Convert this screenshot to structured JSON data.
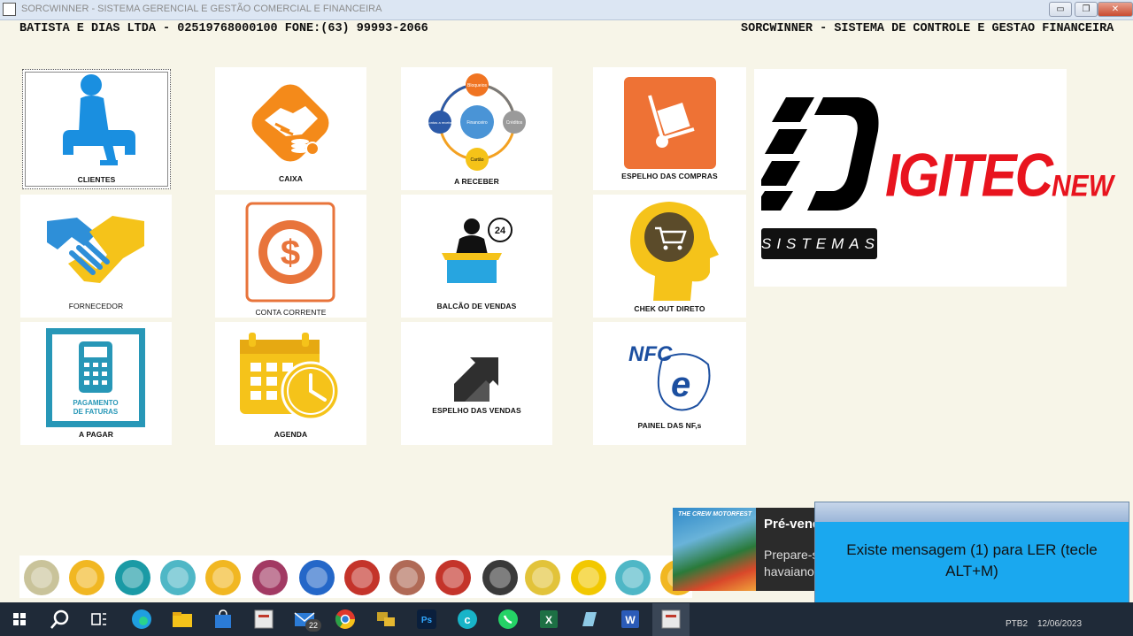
{
  "window": {
    "title": "SORCWINNER - SISTEMA GERENCIAL E GESTÃO COMERCIAL E FINANCEIRA",
    "minimize": "▭",
    "restore": "❐",
    "close": "✕"
  },
  "header": {
    "company": "BATISTA E DIAS LTDA - 02519768000100 FONE:(63) 99993-2066",
    "system": "SORCWINNER -  SISTEMA DE CONTROLE E GESTÃO FINANCEIRA"
  },
  "tiles": {
    "clientes": "CLIENTES",
    "caixa": "CAIXA",
    "a_receber": "A RECEBER",
    "espelho_compras": "ESPELHO DAS COMPRAS",
    "fornecedor": "FORNECEDOR",
    "conta_corrente": "CONTA CORRENTE",
    "balcao_vendas": "BALCÃO DE VENDAS",
    "checkout_direto": "CHEK OUT DIRETO",
    "a_pagar": "A PAGAR",
    "agenda": "AGENDA",
    "espelho_vendas": "ESPELHO DAS VENDAS",
    "painel_nfs": "PAINEL DAS NF,s"
  },
  "icon_text": {
    "receber_cycle": [
      "Bloqueios",
      "Créditos",
      "Cartão",
      "Contas a receber",
      "Financeiro"
    ],
    "pagamento": [
      "PAGAMENTO",
      "DE FATURAS"
    ],
    "nfce": "NFC",
    "nfce_e": "e",
    "balcao_24": "24"
  },
  "logo": {
    "word": "IGITEC",
    "suffix": "NEW",
    "sistemas": "SISTEMAS"
  },
  "quickbar_colors": [
    "#c9c39a",
    "#f1b722",
    "#1b9aa5",
    "#4fb7c6",
    "#f1b722",
    "#a23a63",
    "#2467c8",
    "#c4342a",
    "#b06a56",
    "#c4342a",
    "#3a3a3a",
    "#e2c33a",
    "#f2c800",
    "#4fb7c6",
    "#f1b722"
  ],
  "notification": {
    "title": "Pré-venda",
    "body_line1": "Prepare-se",
    "body_line2": "havaiano",
    "thumb_text": "THE CREW MOTORFEST"
  },
  "message": {
    "text": "Existe mensagem (1) para LER (tecle ALT+M)"
  },
  "taskbar": {
    "mail_badge": "22",
    "lang": "PTB2",
    "date": "12/06/2023"
  }
}
